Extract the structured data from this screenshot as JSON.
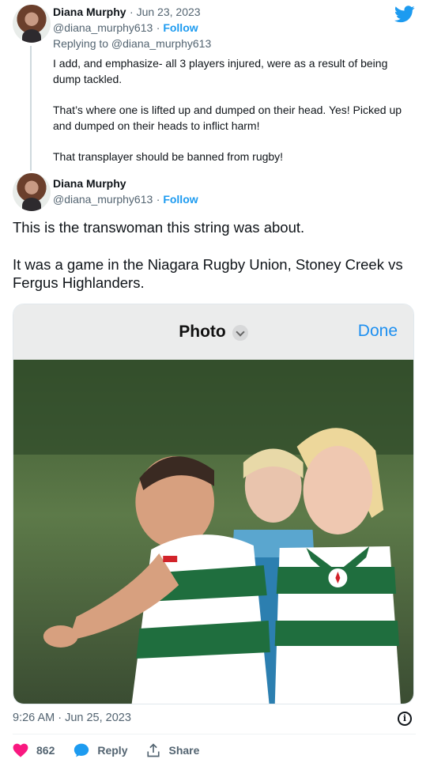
{
  "reply_tweet": {
    "author_name": "Diana Murphy",
    "date": "Jun 23, 2023",
    "handle": "@diana_murphy613",
    "follow_label": "Follow",
    "replying_to": "Replying to @diana_murphy613",
    "paragraphs": [
      "I add, and emphasize- all 3 players injured, were as a result of being dump tackled.",
      "That’s where one is lifted up and dumped on their head.   Yes!  Picked up and dumped on their heads to inflict harm!",
      "That transplayer should be banned from rugby!"
    ]
  },
  "main_tweet": {
    "author_name": "Diana Murphy",
    "handle": "@diana_murphy613",
    "follow_label": "Follow",
    "paragraphs": [
      "This is the transwoman this string was about.",
      "It was a game in the Niagara Rugby Union, Stoney Creek vs Fergus Highlanders."
    ],
    "media": {
      "title": "Photo",
      "done_label": "Done"
    },
    "timestamp": "9:26 AM · Jun 25, 2023",
    "actions": {
      "like_count": "862",
      "reply_label": "Reply",
      "share_label": "Share"
    }
  },
  "colors": {
    "accent": "#1d9bf0",
    "like": "#f91880",
    "secondary_text": "#536471"
  },
  "icons": [
    "twitter-bird-icon",
    "chevron-down-icon",
    "info-icon",
    "heart-icon",
    "reply-bubble-icon",
    "share-icon"
  ]
}
